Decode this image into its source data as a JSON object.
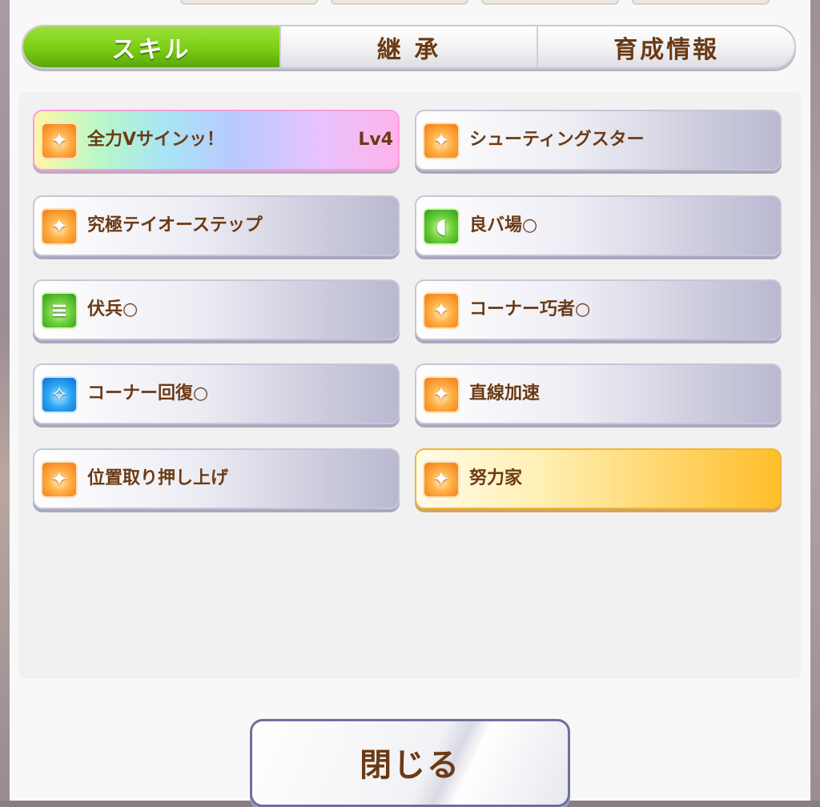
{
  "tabs": [
    {
      "label": "スキル",
      "active": true
    },
    {
      "label": "継 承",
      "active": false
    },
    {
      "label": "育成情報",
      "active": false
    }
  ],
  "skills": [
    {
      "name": "全力Vサインッ！",
      "level": "Lv4",
      "icon": "running-flame-icon",
      "style": "rainbow"
    },
    {
      "name": "シューティングスター",
      "icon": "running-flame-icon",
      "style": "normal"
    },
    {
      "name": "究極テイオーステップ",
      "icon": "running-flame-icon",
      "style": "normal"
    },
    {
      "name": "良バ場○",
      "icon": "green-power-icon",
      "style": "normal"
    },
    {
      "name": "伏兵○",
      "icon": "green-list-icon",
      "style": "normal"
    },
    {
      "name": "コーナー巧者○",
      "icon": "running-flame-icon",
      "style": "normal"
    },
    {
      "name": "コーナー回復○",
      "icon": "blue-sparkle-icon",
      "style": "normal"
    },
    {
      "name": "直線加速",
      "icon": "running-flame-icon",
      "style": "normal"
    },
    {
      "name": "位置取り押し上げ",
      "icon": "running-flame-icon",
      "style": "normal"
    },
    {
      "name": "努力家",
      "icon": "running-flame-icon",
      "style": "gold"
    }
  ],
  "close_button": {
    "label": "閉じる"
  },
  "colors": {
    "active_tab": "#7ccd13",
    "text_brown": "#6b3a14",
    "gold_skill": "#ffbe2a",
    "rainbow_border": "#ff9be0"
  }
}
